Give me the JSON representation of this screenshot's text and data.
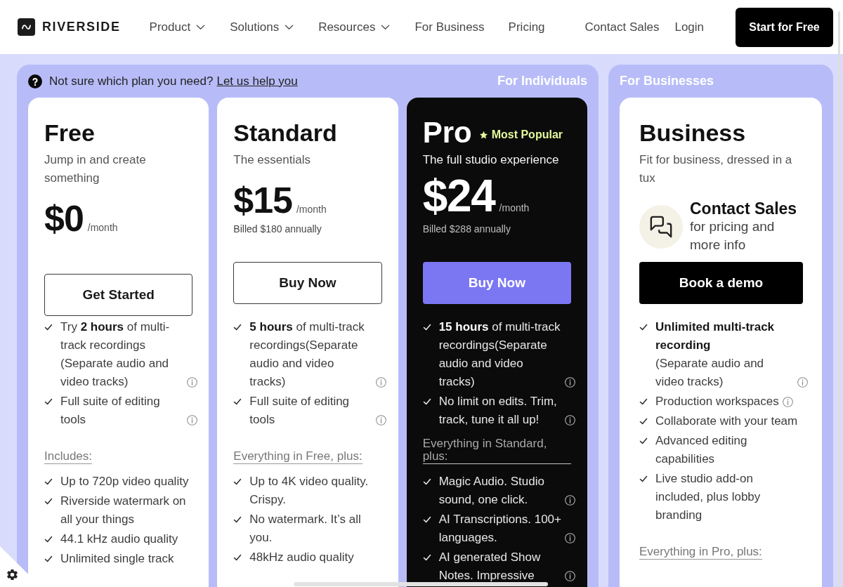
{
  "header": {
    "brand": "RIVERSIDE",
    "nav": [
      {
        "label": "Product",
        "dropdown": true
      },
      {
        "label": "Solutions",
        "dropdown": true
      },
      {
        "label": "Resources",
        "dropdown": true
      },
      {
        "label": "For Business",
        "dropdown": false
      },
      {
        "label": "Pricing",
        "dropdown": false
      }
    ],
    "links": [
      "Contact Sales",
      "Login"
    ],
    "cta": "Start for Free"
  },
  "groups": [
    {
      "label": "For Individuals",
      "help": {
        "text": "Not sure which plan you need?",
        "link": "Let us help you"
      },
      "plans": [
        {
          "name": "Free",
          "featured": false,
          "tagline": "Jump in and create something",
          "price": {
            "amount": "$0",
            "period": "/month"
          },
          "button": {
            "label": "Get Started",
            "kind": "outline"
          },
          "features": [
            {
              "text": "Try **2 hours** of multi-track recordings (Separate audio and video tracks)",
              "info": true
            },
            {
              "text": "Full suite of editing tools",
              "info": true
            }
          ],
          "section": {
            "heading": "Includes:",
            "features": [
              {
                "text": "Up to 720p video quality",
                "info": false
              },
              {
                "text": "Riverside watermark on all your things",
                "info": false
              },
              {
                "text": "44.1 kHz audio quality",
                "info": false
              },
              {
                "text": "Unlimited single track",
                "info": false
              }
            ]
          }
        },
        {
          "name": "Standard",
          "featured": false,
          "tagline": "The essentials",
          "price": {
            "amount": "$15",
            "period": "/month",
            "billing": "Billed $180 annually"
          },
          "button": {
            "label": "Buy Now",
            "kind": "outline"
          },
          "features": [
            {
              "text": "**5 hours** of multi-track recordings(Separate audio and video tracks)",
              "info": true
            },
            {
              "text": "Full suite of editing tools",
              "info": true
            }
          ],
          "section": {
            "heading": "Everything in Free, plus:",
            "features": [
              {
                "text": "Up to 4K video quality. Crispy.",
                "info": false
              },
              {
                "text": "No watermark. It’s all you.",
                "info": false
              },
              {
                "text": "48kHz audio quality",
                "info": false
              }
            ]
          }
        },
        {
          "name": "Pro",
          "badge": "Most Popular",
          "featured": true,
          "tagline": "The full studio experience",
          "price": {
            "amount": "$24",
            "period": "/month",
            "billing": "Billed $288 annually"
          },
          "button": {
            "label": "Buy Now",
            "kind": "primary"
          },
          "features": [
            {
              "text": "**15 hours** of multi-track recordings(Separate audio and video tracks)",
              "info": true
            },
            {
              "text": "No limit on edits. Trim, track, tune it all up!",
              "info": true
            }
          ],
          "section": {
            "heading": "Everything in Standard, plus:",
            "features": [
              {
                "text": "Magic Audio. Studio sound, one click.",
                "info": true
              },
              {
                "text": "AI Transcriptions. 100+ languages.",
                "info": true
              },
              {
                "text": "AI generated Show Notes. Impressive",
                "info": true
              }
            ]
          }
        }
      ]
    },
    {
      "label": "For Businesses",
      "plans": [
        {
          "name": "Business",
          "featured": false,
          "tagline": "Fit for business, dressed in a tux",
          "contact": {
            "title": "Contact Sales",
            "text": "for pricing and more info"
          },
          "button": {
            "label": "Book a demo",
            "kind": "solid"
          },
          "features": [
            {
              "title": "Unlimited multi-track recording",
              "text": "(Separate audio and video tracks)",
              "info": true
            },
            {
              "text": "Production workspaces",
              "info": true
            },
            {
              "text": "Collaborate with your team",
              "info": false
            },
            {
              "text": "Advanced editing capabilities",
              "info": false
            },
            {
              "text": "Live studio add-on included, plus lobby branding",
              "info": false
            }
          ],
          "section": {
            "heading": "Everything in Pro, plus:"
          }
        }
      ]
    }
  ]
}
